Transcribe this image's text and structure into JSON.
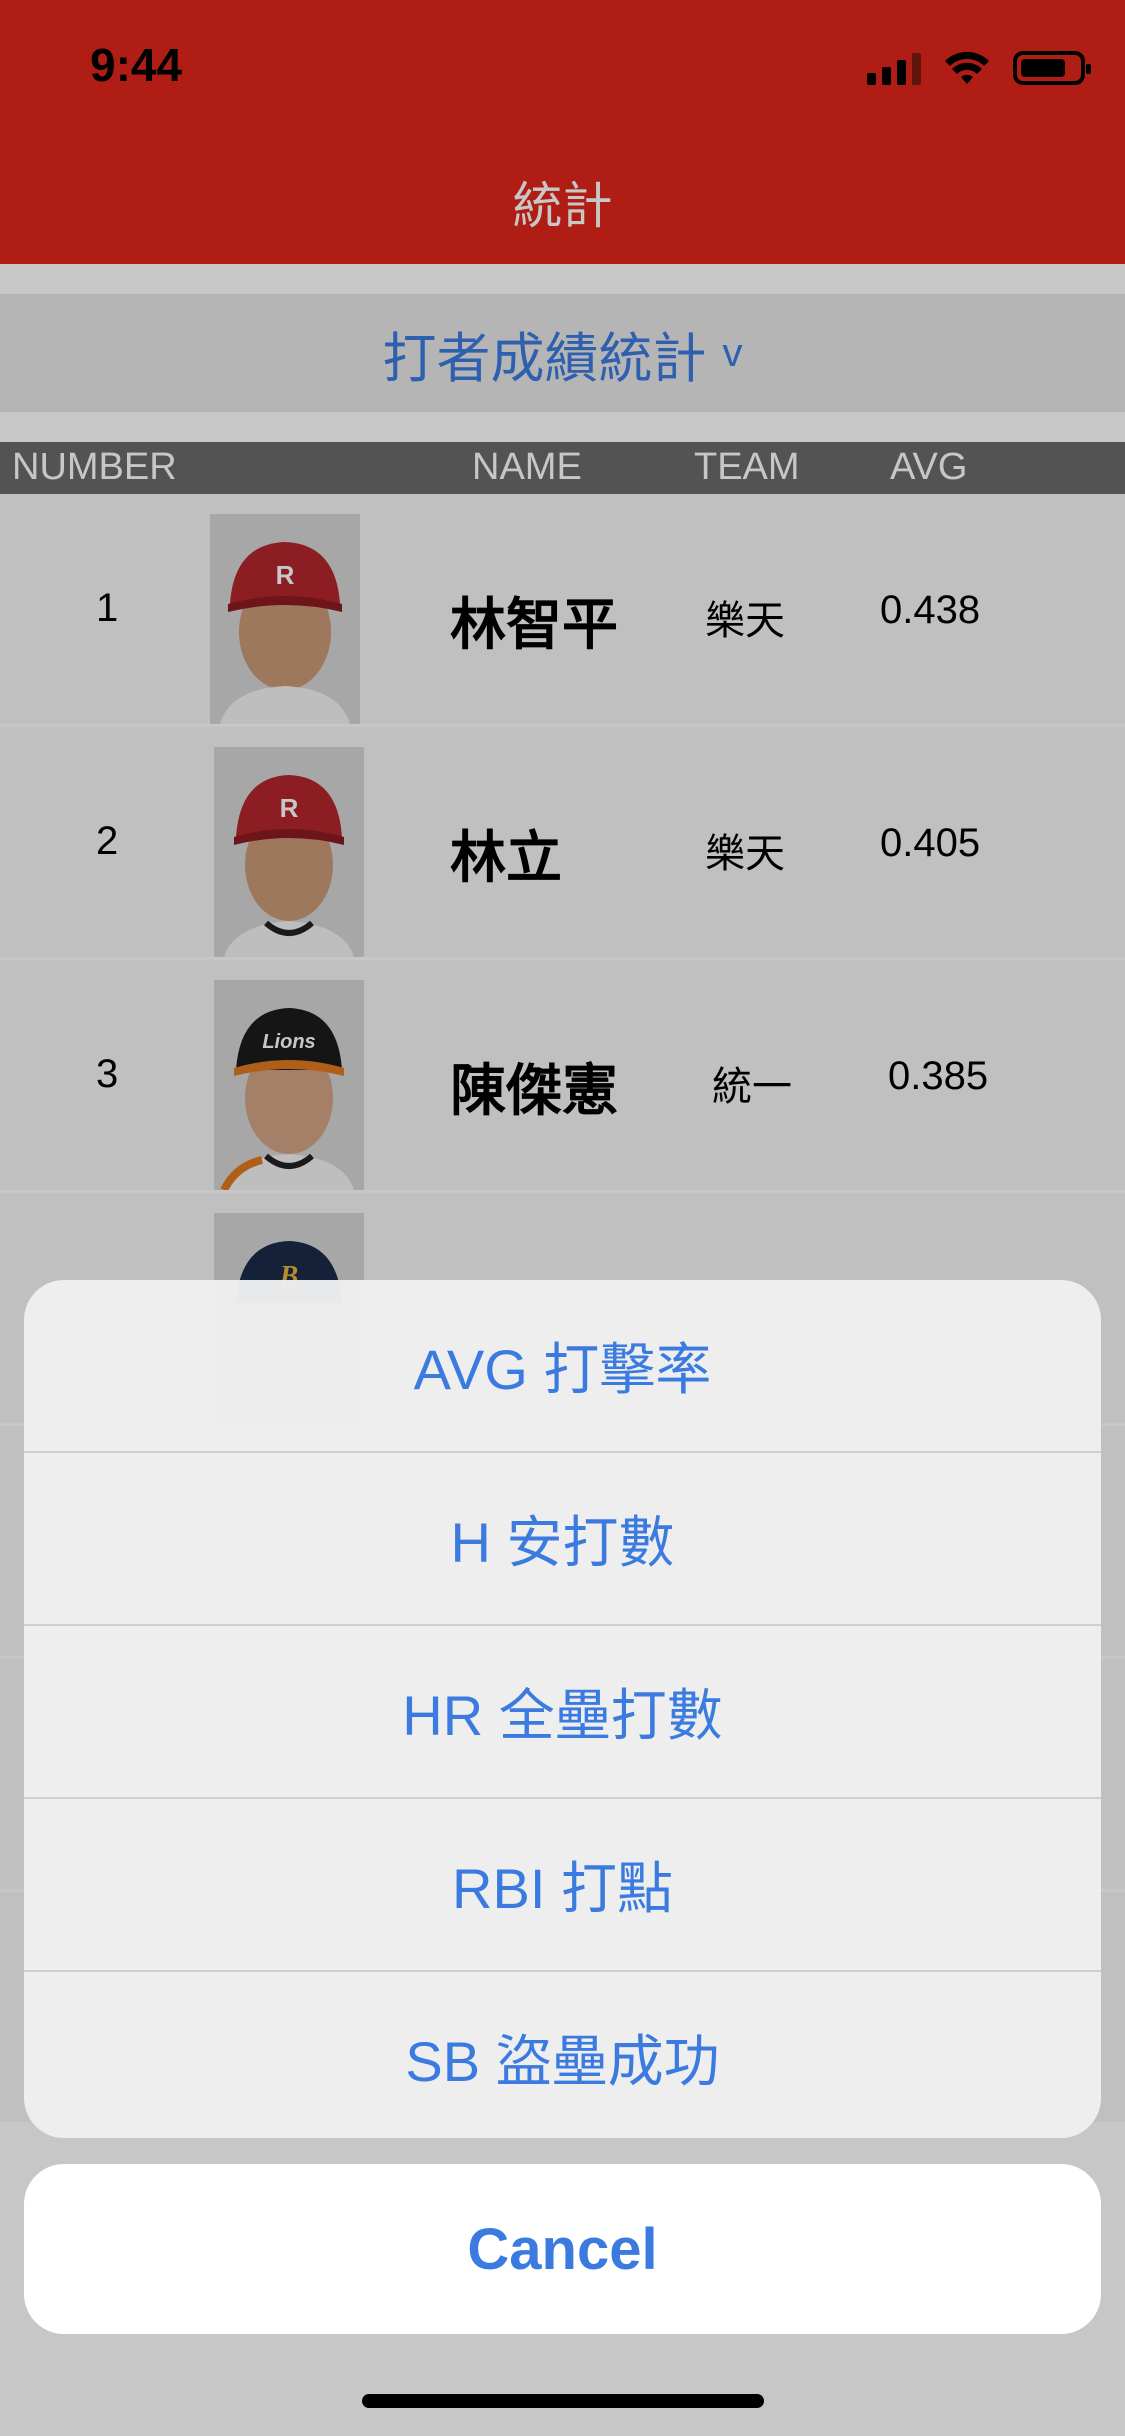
{
  "status": {
    "time": "9:44"
  },
  "nav": {
    "title": "統計"
  },
  "segment": {
    "title": "打者成績統計",
    "caret": "v"
  },
  "table": {
    "headers": {
      "number": "NUMBER",
      "name": "NAME",
      "team": "TEAM",
      "avg": "AVG"
    },
    "rows": [
      {
        "number": "1",
        "name": "林智平",
        "team": "樂天",
        "avg": "0.438",
        "cap_color": "#b3262d",
        "cap_letter": "R"
      },
      {
        "number": "2",
        "name": "林立",
        "team": "樂天",
        "avg": "0.405",
        "cap_color": "#b3262d",
        "cap_letter": "R"
      },
      {
        "number": "3",
        "name": "陳傑憲",
        "team": "統一",
        "avg": "0.385",
        "cap_color": "#1b1b1b",
        "cap_letter": "Lions"
      },
      {
        "number": "",
        "name": "",
        "team": "",
        "avg": "",
        "cap_color": "#1c2a4a",
        "cap_letter": "B"
      }
    ]
  },
  "action_sheet": {
    "options": [
      "AVG 打擊率",
      "H 安打數",
      "HR 全壘打數",
      "RBI 打點",
      "SB 盜壘成功"
    ],
    "cancel": "Cancel"
  },
  "colors": {
    "accent": "#3b7be0",
    "brand_red": "#e0261b"
  }
}
